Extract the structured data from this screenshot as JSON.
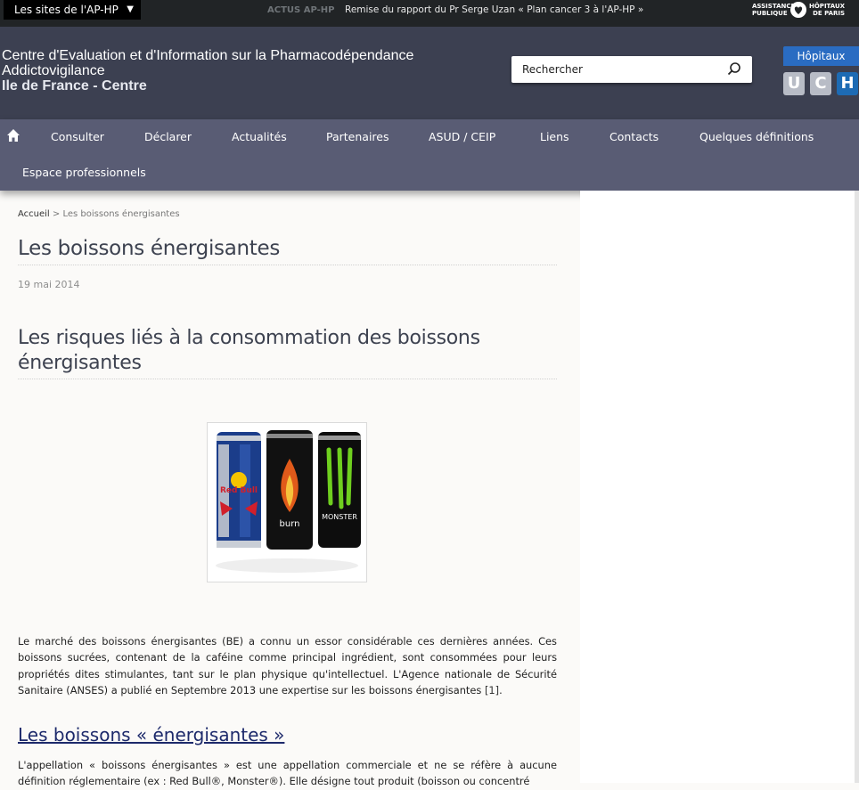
{
  "topbar": {
    "sites_label": "Les sites de l'AP-HP",
    "actus_label": "ACTUS AP-HP",
    "actus_text": "Remise du rapport du Pr Serge Uzan « Plan cancer 3 à l'AP-HP »",
    "logo_left": "ASSISTANCE\nPUBLIQUE",
    "logo_right": "HÔPITAUX\nDE PARIS"
  },
  "header": {
    "title_line1": "Centre d'Evaluation et d'Information sur la Pharmacodépendance",
    "title_line2": "Addictovigilance",
    "title_line3": "Ile de France - Centre",
    "search_value": "Rechercher",
    "hopitaux_label": "Hôpitaux",
    "uch": [
      "U",
      "C",
      "H"
    ]
  },
  "nav": {
    "items": [
      "Consulter",
      "Déclarer",
      "Actualités",
      "Partenaires",
      "ASUD / CEIP",
      "Liens",
      "Contacts",
      "Quelques définitions",
      "Espace professionnels"
    ]
  },
  "breadcrumb": {
    "home": "Accueil",
    "separator": ">",
    "current": "Les boissons énergisantes"
  },
  "article": {
    "title": "Les boissons énergisantes",
    "date": "19 mai 2014",
    "heading": "Les risques liés à la consommation des boissons énergisantes",
    "cans": [
      "Red Bull",
      "burn",
      "MONSTER"
    ],
    "paragraph1": "Le marché des boissons énergisantes (BE) a connu un essor considérable ces dernières années.  Ces boissons sucrées, contenant de la caféine comme principal ingrédient, sont consommées pour leurs propriétés dites stimulantes, tant sur le plan physique qu'intellectuel. L'Agence nationale de Sécurité Sanitaire (ANSES) a publié en Septembre 2013 une expertise sur les boissons énergisantes",
    "paragraph1_ref": "[1]",
    "paragraph1_end": ".",
    "subheading": "Les boissons « énergisantes »",
    "paragraph2": "L'appellation « boissons énergisantes » est une appellation commerciale et ne se réfère à aucune définition réglementaire (ex : Red Bull®, Monster®). Elle désigne tout produit (boisson ou concentré"
  },
  "colors": {
    "topbar": "#212426",
    "header": "#3c4051",
    "nav": "#595c74",
    "accent_blue": "#1d6bb4",
    "link": "#1d2a6b"
  }
}
